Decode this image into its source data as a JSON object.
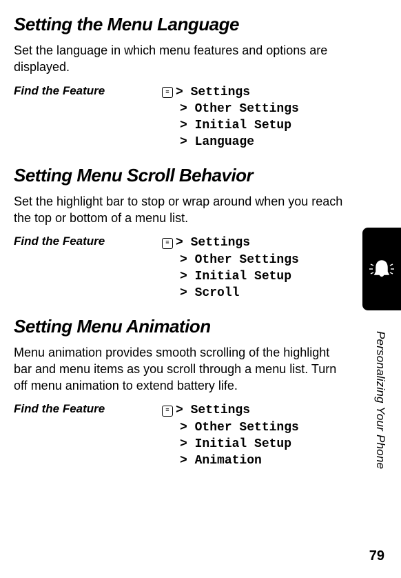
{
  "sections": [
    {
      "heading": "Setting the Menu Language",
      "body": "Set the language in which menu features and options are displayed.",
      "feature_label": "Find the Feature",
      "path": [
        "Settings",
        "Other Settings",
        "Initial Setup",
        "Language"
      ]
    },
    {
      "heading": "Setting Menu Scroll Behavior",
      "body": "Set the highlight bar to stop or wrap around when you reach the top or bottom of a menu list.",
      "feature_label": "Find the Feature",
      "path": [
        "Settings",
        "Other Settings",
        "Initial Setup",
        "Scroll"
      ]
    },
    {
      "heading": "Setting Menu Animation",
      "body": "Menu animation provides smooth scrolling of the highlight bar and menu items as you scroll through a menu list. Turn off menu animation to extend battery life.",
      "feature_label": "Find the Feature",
      "path": [
        "Settings",
        "Other Settings",
        "Initial Setup",
        "Animation"
      ]
    }
  ],
  "side_label": "Personalizing Your Phone",
  "page_number": "79"
}
